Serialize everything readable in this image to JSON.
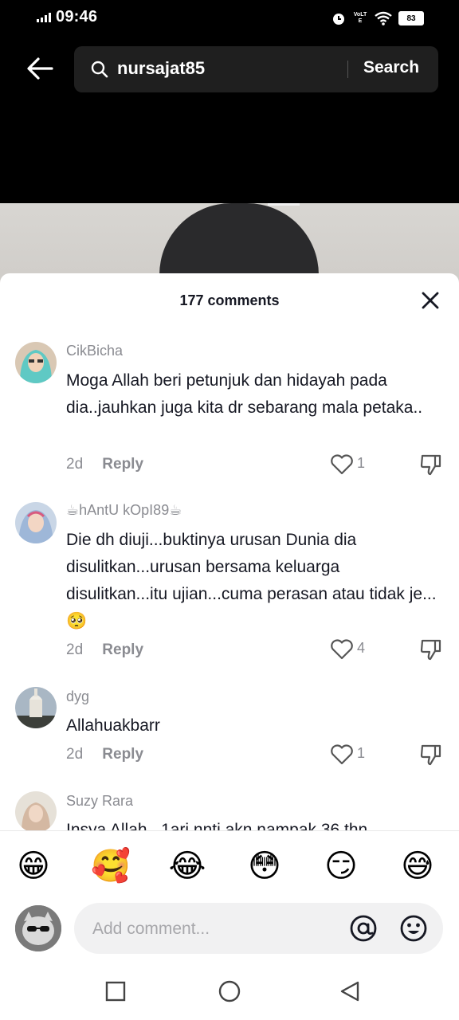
{
  "status_bar": {
    "time": "09:46",
    "network": "VoLTE",
    "battery": "83"
  },
  "search": {
    "query": "nursajat85",
    "button_label": "Search"
  },
  "comments_panel": {
    "count_label": "177 comments",
    "comments": [
      {
        "user": "CikBicha",
        "text": "Moga Allah beri petunjuk dan hidayah pada dia..jauhkan juga kita dr sebarang mala petaka..",
        "date": "2d",
        "reply_label": "Reply",
        "likes": "1"
      },
      {
        "user": "☕hAntU kOpI89☕",
        "text": "Die dh diuji...buktinya urusan Dunia dia disulitkan...urusan bersama keluarga disulitkan...itu ujian...cuma perasan atau tidak je...🥺",
        "date": "2d",
        "reply_label": "Reply",
        "likes": "4"
      },
      {
        "user": "dyg",
        "text": "Allahuakbarr",
        "date": "2d",
        "reply_label": "Reply",
        "likes": "1"
      },
      {
        "user": "Suzy Rara",
        "text": "Insya Allah...1ari nnti akn nampak 36 thn"
      }
    ]
  },
  "emoji_bar": [
    "😁",
    "🥰",
    "😂",
    "😳",
    "😏",
    "😅"
  ],
  "comment_input": {
    "placeholder": "Add comment..."
  },
  "icons": {
    "back": "arrow-left-icon",
    "search": "search-icon",
    "close": "close-icon",
    "like": "heart-icon",
    "dislike": "thumbs-down-icon",
    "mention": "at-icon",
    "emoji": "smiley-icon",
    "nav_recents": "square-icon",
    "nav_home": "circle-icon",
    "nav_back": "triangle-back-icon"
  }
}
